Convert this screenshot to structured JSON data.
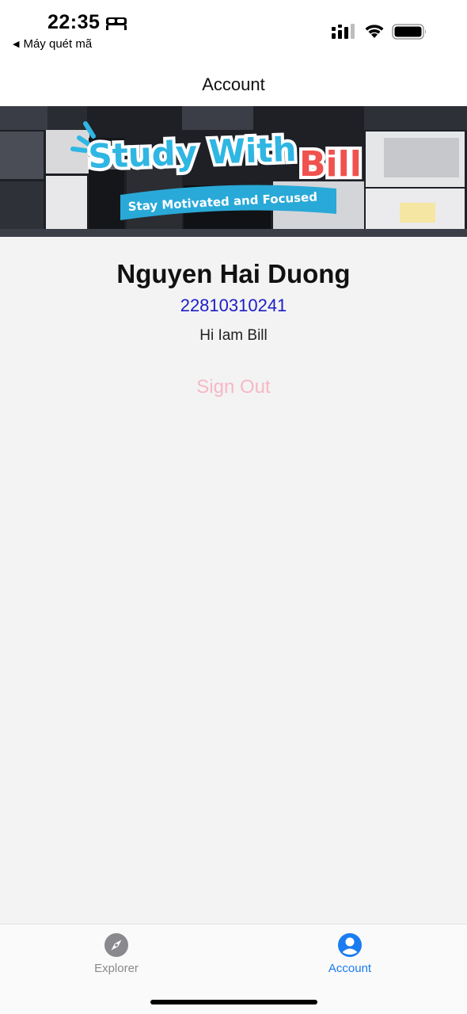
{
  "status_bar": {
    "time": "22:35",
    "back_app_label": "Máy quét mã",
    "icons": [
      "bed-icon",
      "cellular-signal-icon",
      "wifi-icon",
      "battery-icon"
    ]
  },
  "nav": {
    "title": "Account"
  },
  "banner": {
    "title_part1": "Study With",
    "title_part2": "Bill",
    "tagline": "Stay Motivated and Focused",
    "colors": {
      "title_blue": "#2fb6e3",
      "title_red": "#f0524f",
      "ribbon": "#29a9d8"
    }
  },
  "profile": {
    "name": "Nguyen Hai Duong",
    "student_id": "22810310241",
    "bio": "Hi Iam Bill",
    "sign_out_label": "Sign Out"
  },
  "tab_bar": {
    "tabs": [
      {
        "label": "Explorer",
        "icon": "compass-icon",
        "active": false
      },
      {
        "label": "Account",
        "icon": "person-circle-icon",
        "active": true
      }
    ],
    "active_color": "#1a7cf0",
    "inactive_color": "#8a8a8e"
  }
}
